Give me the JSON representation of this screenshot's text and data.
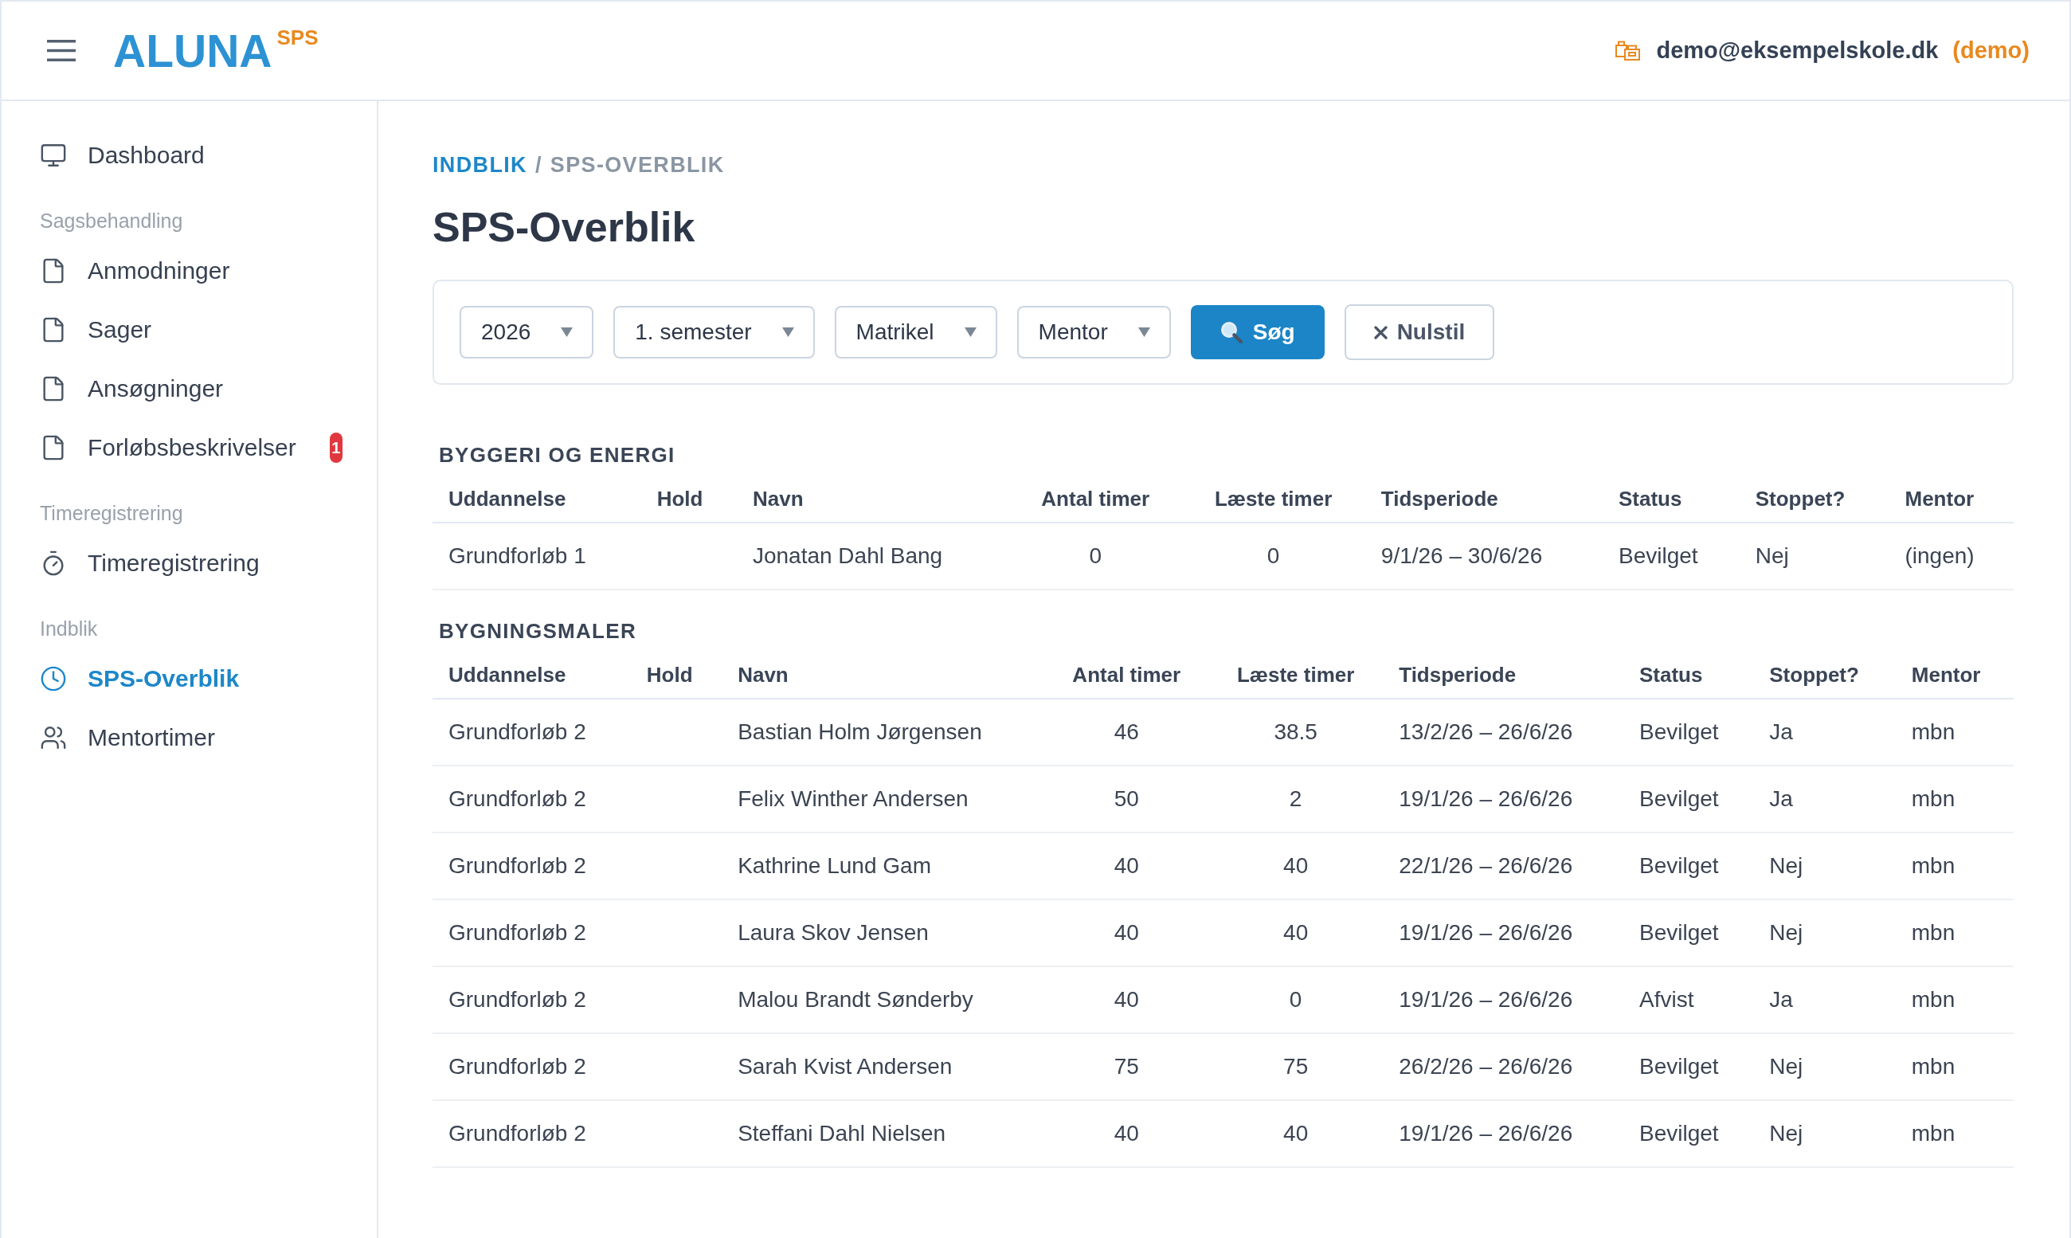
{
  "header": {
    "logo": "ALUNA",
    "logo_sup": "SPS",
    "user_email": "demo@eksempelskole.dk",
    "user_role": "(demo)"
  },
  "sidebar": {
    "groups": [
      {
        "items": [
          {
            "label": "Dashboard",
            "selected": false
          }
        ]
      },
      {
        "title": "Sagsbehandling",
        "items": [
          {
            "label": "Anmodninger",
            "selected": false
          },
          {
            "label": "Sager",
            "selected": false
          },
          {
            "label": "Ansøgninger",
            "selected": false
          },
          {
            "label": "Forløbsbeskrivelser",
            "selected": false,
            "badge": "1"
          }
        ]
      },
      {
        "title": "Timeregistrering",
        "items": [
          {
            "label": "Timeregistrering",
            "selected": false
          }
        ]
      },
      {
        "title": "Indblik",
        "items": [
          {
            "label": "SPS-Overblik",
            "selected": true
          },
          {
            "label": "Mentortimer",
            "selected": false
          }
        ]
      }
    ]
  },
  "breadcrumb": {
    "separator": "/",
    "items": [
      {
        "kind": "link",
        "label": "INDBLIK"
      },
      {
        "kind": "current",
        "label": "SPS-OVERBLIK"
      }
    ]
  },
  "title": "SPS-Overblik",
  "filters": {
    "selects": [
      {
        "value": "2026"
      },
      {
        "value": "1. semester"
      },
      {
        "value": "Matrikel"
      },
      {
        "value": "Mentor"
      }
    ],
    "buttons": [
      {
        "kind": "primary",
        "label": "Søg"
      },
      {
        "kind": "secondary",
        "label": "Nulstil"
      }
    ]
  },
  "tables": [
    {
      "title": "BYGGERI OG ENERGI",
      "columns": [
        "Uddannelse",
        "Hold",
        "Navn",
        "Antal timer",
        "Læste timer",
        "Tidsperiode",
        "Status",
        "Stoppet?",
        "Mentor"
      ],
      "rows": [
        {
          "education": "Grundforløb 1",
          "name": "Jonatan Dahl Bang",
          "hours": "0",
          "hours_read": "0",
          "period": "9/1/26 – 30/6/26",
          "status": "Bevilget",
          "stopped": "Nej",
          "mentor": "(ingen)"
        }
      ]
    },
    {
      "title": "BYGNINGSMALER",
      "columns": [
        "Uddannelse",
        "Hold",
        "Navn",
        "Antal timer",
        "Læste timer",
        "Tidsperiode",
        "Status",
        "Stoppet?",
        "Mentor"
      ],
      "rows": [
        {
          "education": "Grundforløb 2",
          "name": "Bastian Holm Jørgensen",
          "hours": "46",
          "hours_read": "38.5",
          "period": "13/2/26 – 26/6/26",
          "status": "Bevilget",
          "stopped": "Ja",
          "mentor": "mbn"
        },
        {
          "education": "Grundforløb 2",
          "name": "Felix Winther Andersen",
          "hours": "50",
          "hours_read": "2",
          "period": "19/1/26 – 26/6/26",
          "status": "Bevilget",
          "stopped": "Ja",
          "mentor": "mbn"
        },
        {
          "education": "Grundforløb 2",
          "name": "Kathrine Lund Gam",
          "hours": "40",
          "hours_read": "40",
          "period": "22/1/26 – 26/6/26",
          "status": "Bevilget",
          "stopped": "Nej",
          "mentor": "mbn"
        },
        {
          "education": "Grundforløb 2",
          "name": "Laura Skov Jensen",
          "hours": "40",
          "hours_read": "40",
          "period": "19/1/26 – 26/6/26",
          "status": "Bevilget",
          "stopped": "Nej",
          "mentor": "mbn"
        },
        {
          "education": "Grundforløb 2",
          "name": "Malou Brandt Sønderby",
          "hours": "40",
          "hours_read": "0",
          "period": "19/1/26 – 26/6/26",
          "status": "Afvist",
          "stopped": "Ja",
          "mentor": "mbn"
        },
        {
          "education": "Grundforløb 2",
          "name": "Sarah Kvist Andersen",
          "hours": "75",
          "hours_read": "75",
          "period": "26/2/26 – 26/6/26",
          "status": "Bevilget",
          "stopped": "Nej",
          "mentor": "mbn"
        },
        {
          "education": "Grundforløb 2",
          "name": "Steffani Dahl Nielsen",
          "hours": "40",
          "hours_read": "40",
          "period": "19/1/26 – 26/6/26",
          "status": "Bevilget",
          "stopped": "Nej",
          "mentor": "mbn"
        }
      ]
    }
  ]
}
